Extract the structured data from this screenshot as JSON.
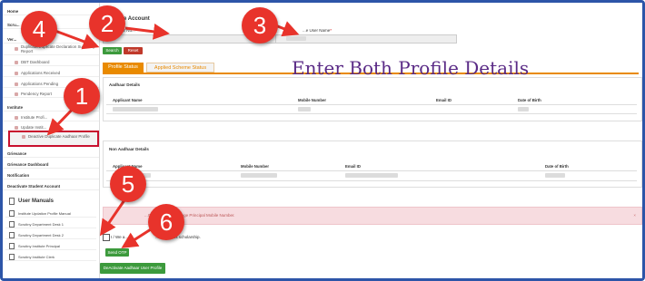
{
  "sidebar": {
    "items": [
      {
        "label": "Home"
      },
      {
        "label": "Scru..."
      },
      {
        "label": "Ver..."
      },
      {
        "label": "Duplicate/Duplicate Declaration Summary Report"
      },
      {
        "label": "DBT Dashboard"
      },
      {
        "label": "Applications Received"
      },
      {
        "label": "Applications Pending"
      },
      {
        "label": "Pendency Report"
      },
      {
        "label": "Institute"
      },
      {
        "label": "Institute Profi..."
      },
      {
        "label": "Update Instit..."
      },
      {
        "label": "Deactive Duplicate Aadhaar Profile"
      },
      {
        "label": "Grievance"
      },
      {
        "label": "Grievance Dashboard"
      },
      {
        "label": "Notification"
      },
      {
        "label": "Deactivate Student Account"
      }
    ],
    "manuals_heading": "User Manuals",
    "manuals": [
      {
        "label": "Institute Updation Profile Manual"
      },
      {
        "label": "Scrutiny Department Desk 1"
      },
      {
        "label": "Scrutiny Department Desk 2"
      },
      {
        "label": "Scrutiny Institute Principal"
      },
      {
        "label": "Scrutiny Institute Clerk"
      }
    ]
  },
  "form": {
    "title": "...e Account",
    "field1_label": "Aadhaar Nu...",
    "field2_label": "...e User Name",
    "required_mark": "*",
    "search_button": "Search",
    "reset_button": "Reset"
  },
  "tabs": [
    {
      "label": "Profile Status"
    },
    {
      "label": "Applied Scheme Status"
    }
  ],
  "aadhaar_panel": {
    "title": "Aadhaar Details",
    "columns": [
      "Applicant Name",
      "Mobile Number",
      "Email ID",
      "Date of Birth"
    ]
  },
  "non_aadhaar_panel": {
    "title": "Non Aadhaar Details",
    "columns": [
      "Applicant Name",
      "Mobile Number",
      "Email ID",
      "Date of Birth"
    ]
  },
  "alert": {
    "text": "...OTP will get ...College Principal Mobile Number.",
    "close": "×"
  },
  "consent": {
    "text": "I / We a...                        ...nes of this scholarship."
  },
  "buttons": {
    "send_otp": "Send OTP",
    "deactivate": "DeActivate Aadhaar User Profile"
  },
  "overlay": {
    "caption": "Enter Both Profile Details",
    "badges": [
      "1",
      "2",
      "3",
      "4",
      "5",
      "6"
    ]
  },
  "colors": {
    "frame": "#2d55a8",
    "badge": "#e8332b",
    "highlight": "#c8102e",
    "search_green": "#3c9a3c",
    "reset_red": "#c0392b",
    "tab_orange": "#e98a00",
    "caption_purple": "#5a2a86"
  }
}
